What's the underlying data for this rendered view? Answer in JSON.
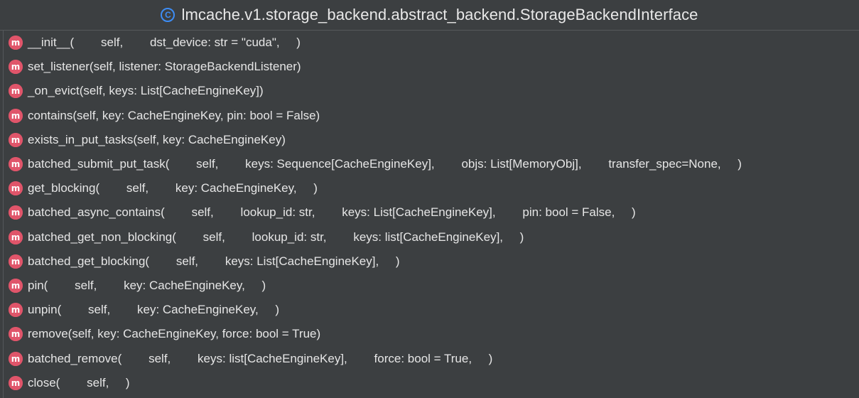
{
  "header": {
    "icon": "class-icon",
    "icon_glyph": "C",
    "title": "lmcache.v1.storage_backend.abstract_backend.StorageBackendInterface"
  },
  "colors": {
    "class_icon": "#3d8df5",
    "method_icon": "#e0556a",
    "background": "#3c3f41"
  },
  "method_icon_glyph": "m",
  "methods": [
    "__init__(        self,        dst_device: str = \"cuda\",     )",
    "set_listener(self, listener: StorageBackendListener)",
    "_on_evict(self, keys: List[CacheEngineKey])",
    "contains(self, key: CacheEngineKey, pin: bool = False)",
    "exists_in_put_tasks(self, key: CacheEngineKey)",
    "batched_submit_put_task(        self,        keys: Sequence[CacheEngineKey],        objs: List[MemoryObj],        transfer_spec=None,     )",
    "get_blocking(        self,        key: CacheEngineKey,     )",
    "batched_async_contains(        self,        lookup_id: str,        keys: List[CacheEngineKey],        pin: bool = False,     )",
    "batched_get_non_blocking(        self,        lookup_id: str,        keys: list[CacheEngineKey],     )",
    "batched_get_blocking(        self,        keys: List[CacheEngineKey],     )",
    "pin(        self,        key: CacheEngineKey,     )",
    "unpin(        self,        key: CacheEngineKey,     )",
    "remove(self, key: CacheEngineKey, force: bool = True)",
    "batched_remove(        self,        keys: list[CacheEngineKey],        force: bool = True,     )",
    "close(        self,     )"
  ]
}
